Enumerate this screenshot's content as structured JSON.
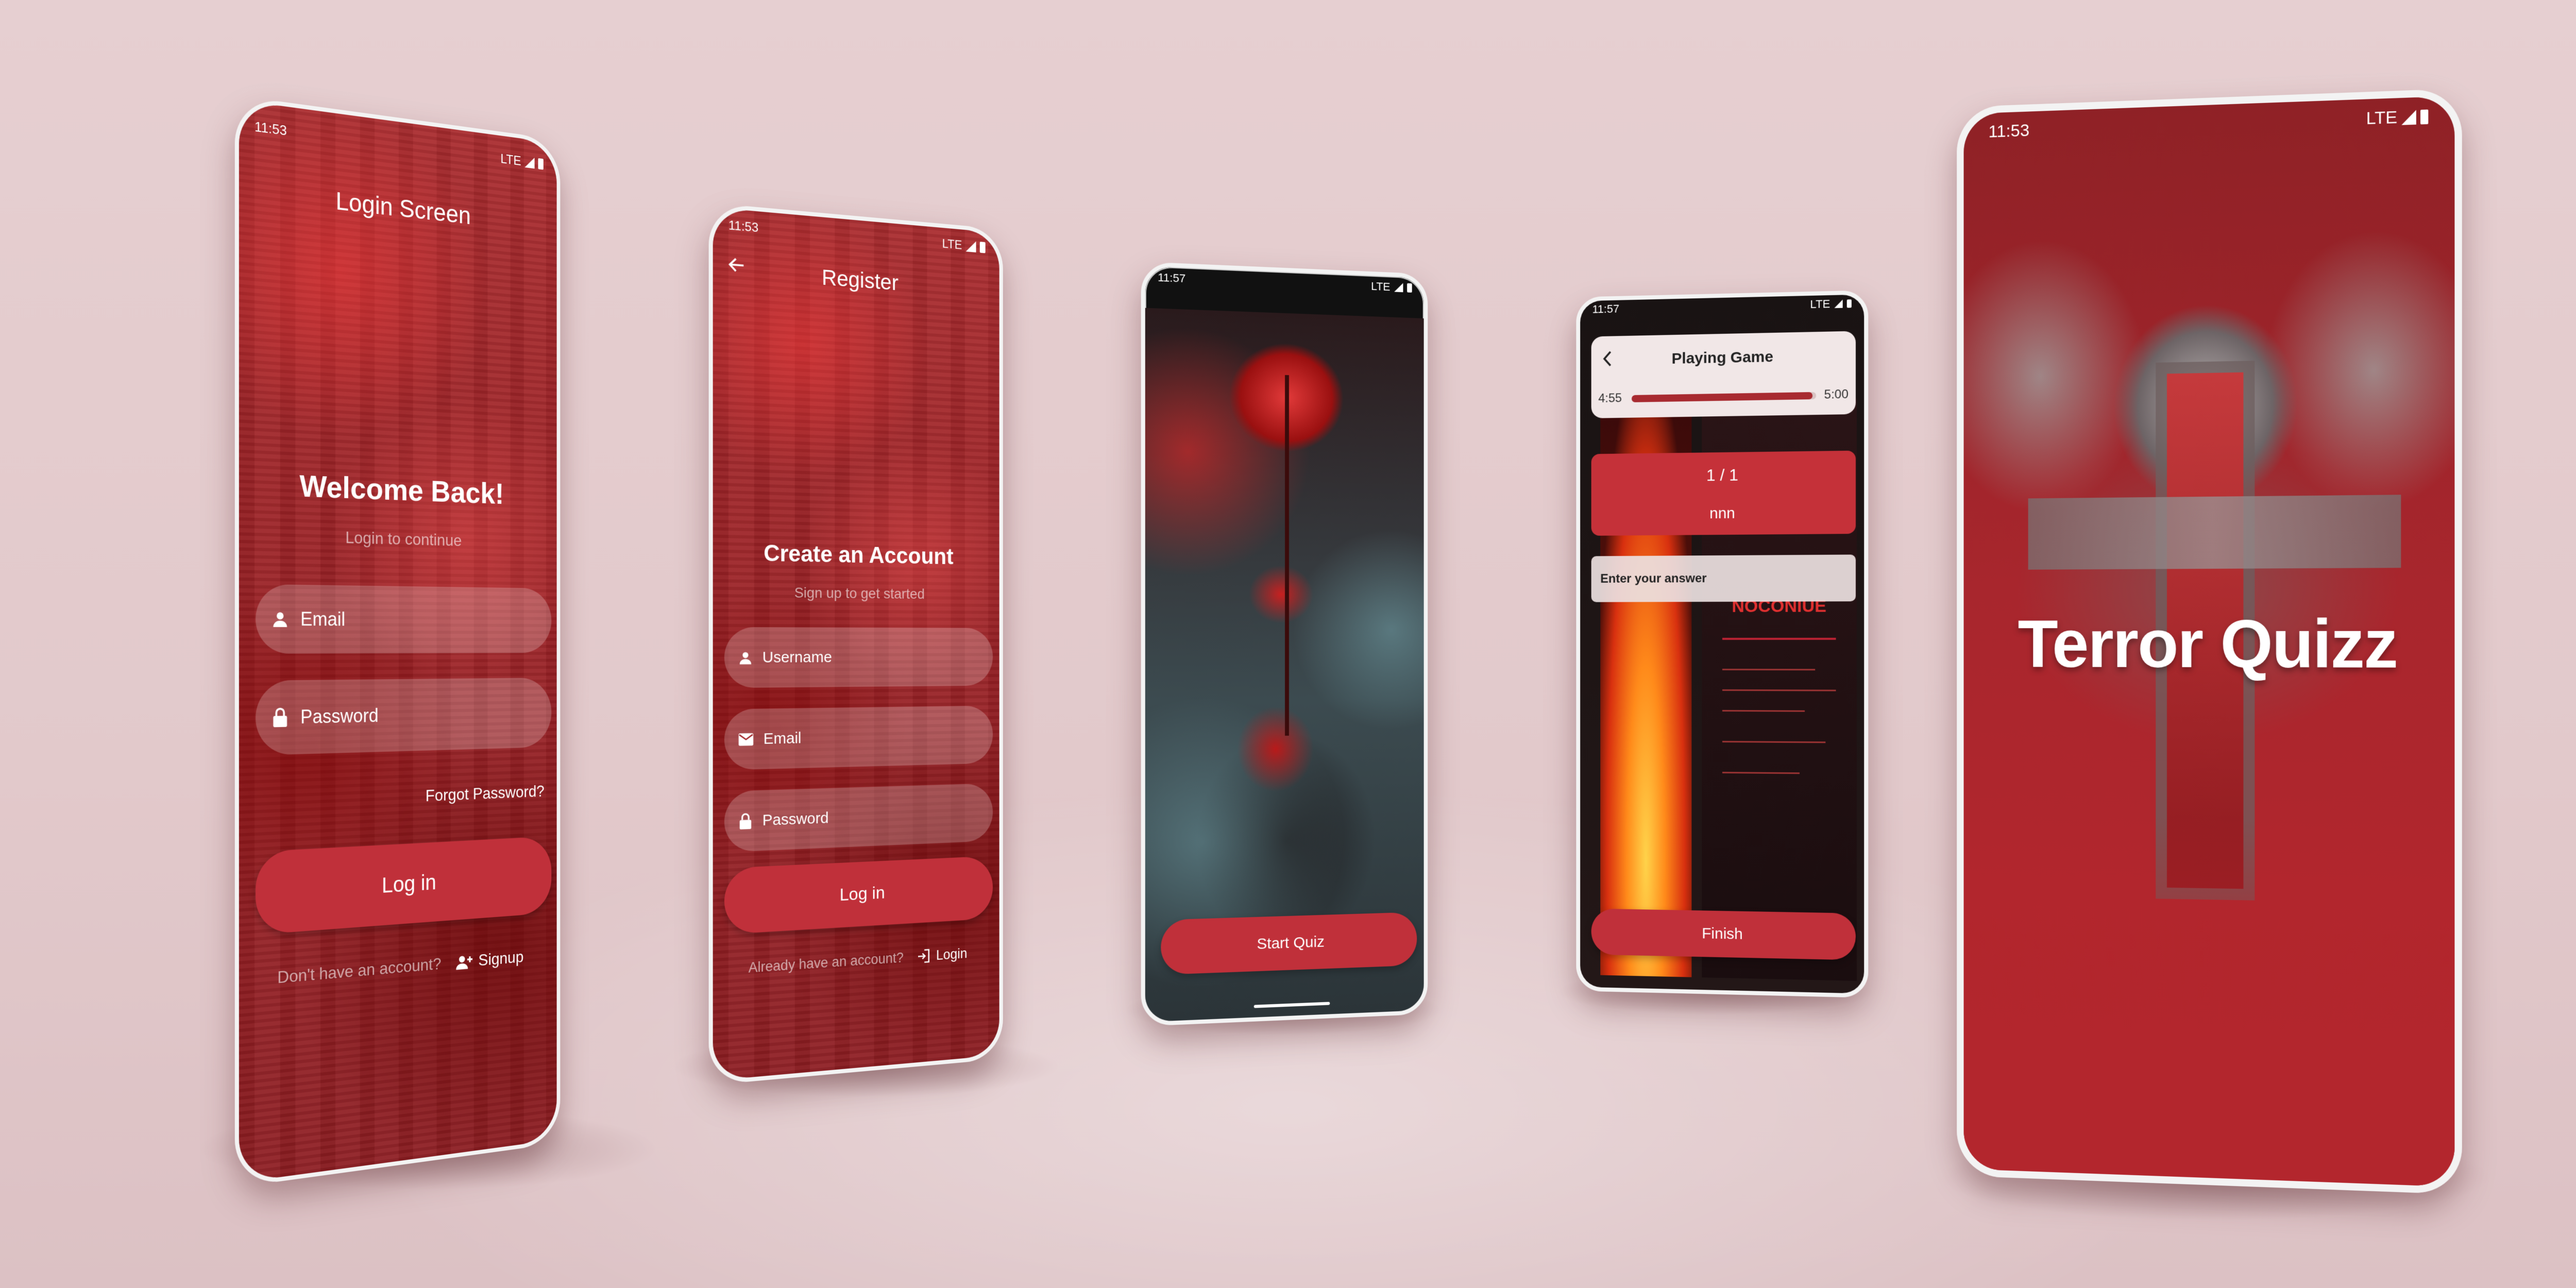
{
  "colors": {
    "primary_red": "#c0303a",
    "screen_red": "#9c2226",
    "background": "#e2c9cb"
  },
  "login": {
    "time": "11:53",
    "network": "LTE",
    "title": "Login Screen",
    "welcome": "Welcome Back!",
    "subtitle": "Login to continue",
    "email_placeholder": "Email",
    "password_placeholder": "Password",
    "forgot": "Forgot Password?",
    "login_button": "Log in",
    "no_account": "Don't have an account?",
    "signup": "Signup",
    "icons": [
      "person-icon",
      "lock-icon",
      "person-add-icon"
    ]
  },
  "register": {
    "time": "11:53",
    "network": "LTE",
    "title": "Register",
    "heading": "Create an Account",
    "subtitle": "Sign up to get started",
    "username_placeholder": "Username",
    "email_placeholder": "Email",
    "password_placeholder": "Password",
    "login_button": "Log in",
    "have_account": "Already have an account?",
    "login_link": "Login",
    "icons": [
      "back-arrow-icon",
      "person-icon",
      "mail-icon",
      "lock-icon",
      "login-icon"
    ]
  },
  "start": {
    "time": "11:57",
    "network": "LTE",
    "start_button": "Start Quiz"
  },
  "game": {
    "time": "11:57",
    "network": "LTE",
    "title": "Playing Game",
    "timer_current": "4:55",
    "timer_total": "5:00",
    "progress": 0.98,
    "question_count": "1 / 1",
    "question_text": "nnn",
    "answer_placeholder": "Enter your answer",
    "finish_button": "Finish",
    "poster_title": "NOCONIUE"
  },
  "splash": {
    "time": "11:53",
    "network": "LTE",
    "title": "Terror Quizz"
  }
}
